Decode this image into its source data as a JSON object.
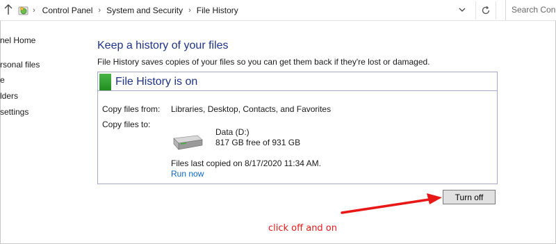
{
  "address_bar": {
    "breadcrumbs": [
      "Control Panel",
      "System and Security",
      "File History"
    ],
    "search_placeholder": "Search Con"
  },
  "left_nav": {
    "items": [
      "nel Home",
      "rsonal files",
      "e",
      "lders",
      "settings"
    ]
  },
  "main": {
    "heading": "Keep a history of your files",
    "description": "File History saves copies of your files so you can get them back if they're lost or damaged.",
    "panel": {
      "title": "File History is on",
      "status_color": "#2e9b2e",
      "copy_from_label": "Copy files from:",
      "copy_from_value": "Libraries, Desktop, Contacts, and Favorites",
      "copy_to_label": "Copy files to:",
      "drive_icon": "hard-drive-icon",
      "drive_name": "Data (D:)",
      "drive_space": "817 GB free of 931 GB",
      "last_copied": "Files last copied on 8/17/2020 11:34 AM.",
      "run_now_label": "Run now"
    },
    "turn_off_label": "Turn off"
  },
  "annotation": {
    "text": "click off and on",
    "color": "#e81818"
  }
}
